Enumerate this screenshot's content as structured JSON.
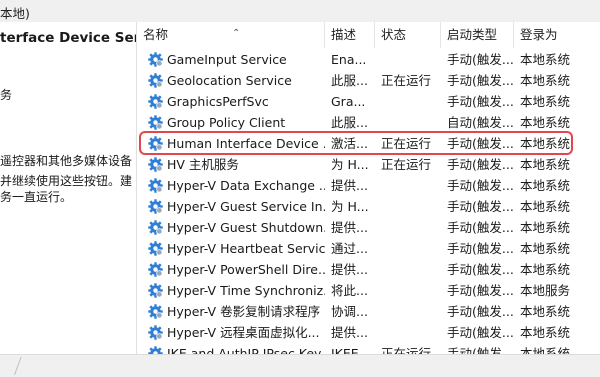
{
  "window": {
    "title_fragment": "本地)"
  },
  "left_panel": {
    "service_title": "terface Device Service",
    "line1": "务",
    "desc1": "遥控器和其他多媒体设备",
    "desc2": "并继续使用这些按钮。建",
    "desc3": "务一直运行。"
  },
  "columns": {
    "name": "名称",
    "desc": "描述",
    "status": "状态",
    "startup": "启动类型",
    "logon": "登录为"
  },
  "rows": [
    {
      "name": "GameInput Service",
      "desc": "Ena...",
      "status": "",
      "startup": "手动(触发...",
      "logon": "本地系统"
    },
    {
      "name": "Geolocation Service",
      "desc": "此服...",
      "status": "正在运行",
      "startup": "手动(触发...",
      "logon": "本地系统"
    },
    {
      "name": "GraphicsPerfSvc",
      "desc": "Gra...",
      "status": "",
      "startup": "手动(触发...",
      "logon": "本地系统"
    },
    {
      "name": "Group Policy Client",
      "desc": "此服...",
      "status": "",
      "startup": "自动(触发...",
      "logon": "本地系统"
    },
    {
      "name": "Human Interface Device ...",
      "desc": "激活...",
      "status": "正在运行",
      "startup": "手动(触发...",
      "logon": "本地系统"
    },
    {
      "name": "HV 主机服务",
      "desc": "为 H...",
      "status": "正在运行",
      "startup": "手动(触发...",
      "logon": "本地系统"
    },
    {
      "name": "Hyper-V Data Exchange ...",
      "desc": "提供...",
      "status": "",
      "startup": "手动(触发...",
      "logon": "本地系统"
    },
    {
      "name": "Hyper-V Guest Service In...",
      "desc": "为 H...",
      "status": "",
      "startup": "手动(触发...",
      "logon": "本地系统"
    },
    {
      "name": "Hyper-V Guest Shutdown...",
      "desc": "提供...",
      "status": "",
      "startup": "手动(触发...",
      "logon": "本地系统"
    },
    {
      "name": "Hyper-V Heartbeat Service",
      "desc": "通过...",
      "status": "",
      "startup": "手动(触发...",
      "logon": "本地系统"
    },
    {
      "name": "Hyper-V PowerShell Dire...",
      "desc": "提供...",
      "status": "",
      "startup": "手动(触发...",
      "logon": "本地系统"
    },
    {
      "name": "Hyper-V Time Synchroniz...",
      "desc": "将此...",
      "status": "",
      "startup": "手动(触发...",
      "logon": "本地服务"
    },
    {
      "name": "Hyper-V 卷影复制请求程序",
      "desc": "协调...",
      "status": "",
      "startup": "手动(触发...",
      "logon": "本地系统"
    },
    {
      "name": "Hyper-V 远程桌面虚拟化...",
      "desc": "提供...",
      "status": "",
      "startup": "手动(触发...",
      "logon": "本地系统"
    },
    {
      "name": "IKE and AuthIP IPsec Key...",
      "desc": "IKEE...",
      "status": "正在运行",
      "startup": "手动(触发...",
      "logon": "本地系统"
    }
  ],
  "selected_index": 4,
  "colors": {
    "highlight": "#e5454c",
    "gear": "#2f7fd6"
  }
}
